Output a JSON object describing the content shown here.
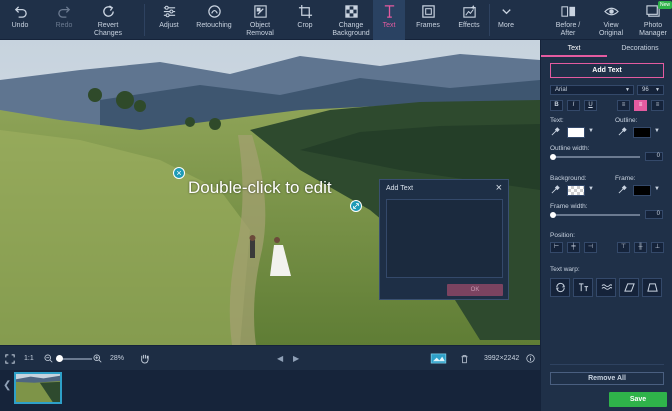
{
  "toolbar": {
    "undo": "Undo",
    "redo": "Redo",
    "revert": "Revert\nChanges",
    "adjust": "Adjust",
    "retouching": "Retouching",
    "object_removal": "Object\nRemoval",
    "crop": "Crop",
    "change_background": "Change\nBackground",
    "text": "Text",
    "frames": "Frames",
    "effects": "Effects",
    "more": "More",
    "before_after": "Before /\nAfter",
    "view_original": "View\nOriginal",
    "photo_manager": "Photo\nManager",
    "new_badge": "New"
  },
  "canvas": {
    "text_placeholder": "Double-click to edit"
  },
  "dialog": {
    "title": "Add Text",
    "close": "×",
    "ok": "OK"
  },
  "statusbar": {
    "one_to_one": "1:1",
    "zoom": "28%",
    "dimensions": "3992×2242"
  },
  "panel": {
    "tab_text": "Text",
    "tab_decorations": "Decorations",
    "add_text": "Add Text",
    "font": "Arial",
    "font_size": "96",
    "bold": "B",
    "italic": "I",
    "underline": "U",
    "text_label": "Text:",
    "outline_label": "Outline:",
    "outline_width_label": "Outline width:",
    "outline_width_value": "0",
    "background_label": "Background:",
    "frame_label": "Frame:",
    "frame_width_label": "Frame width:",
    "frame_width_value": "0",
    "position_label": "Position:",
    "text_warp_label": "Text warp:",
    "remove_all": "Remove All",
    "save": "Save"
  },
  "colors": {
    "accent": "#e45ba0",
    "save": "#2fb34a",
    "panel_bg": "#1f3048",
    "handle": "#1e9bb6"
  }
}
